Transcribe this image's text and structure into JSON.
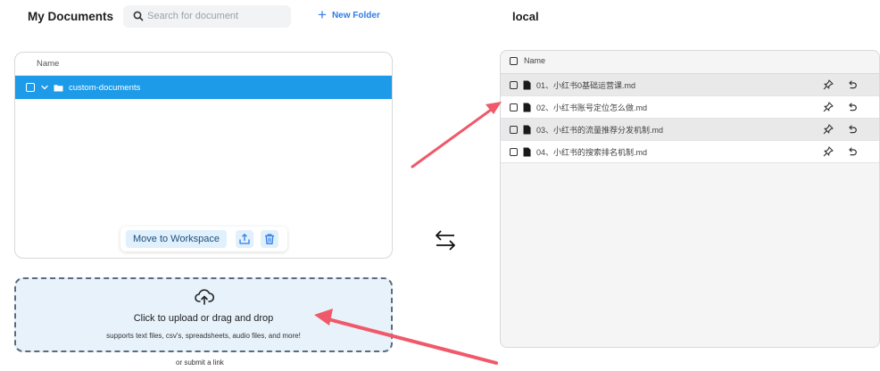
{
  "header": {
    "title": "My Documents",
    "search_placeholder": "Search for document",
    "new_folder_label": "New Folder",
    "local_title": "local"
  },
  "documents": {
    "column_name": "Name",
    "folder": {
      "name": "custom-documents",
      "selected": true,
      "icon": "folder-icon"
    },
    "actions": {
      "move_label": "Move to Workspace",
      "icons": [
        "upload-icon",
        "trash-icon"
      ]
    }
  },
  "upload": {
    "icon": "cloud-upload-icon",
    "title": "Click to upload or drag and drop",
    "subtitle": "supports text files, csv's, spreadsheets, audio files, and more!",
    "submit_link": "or submit a link"
  },
  "swap_icon": "swap-arrows-icon",
  "local": {
    "column_name": "Name",
    "files": [
      {
        "name": "01、小红书0基础运营课.md"
      },
      {
        "name": "02、小红书账号定位怎么做.md"
      },
      {
        "name": "03、小红书的流量推荐分发机制.md"
      },
      {
        "name": "04、小红书的搜索排名机制.md"
      }
    ],
    "row_icons": [
      "pin-icon",
      "undo-icon"
    ]
  },
  "colors": {
    "accent": "#1d9be9",
    "link": "#2f7ce6",
    "annotation_arrow": "#f0596a",
    "upload_bg": "#e7f2fb"
  }
}
